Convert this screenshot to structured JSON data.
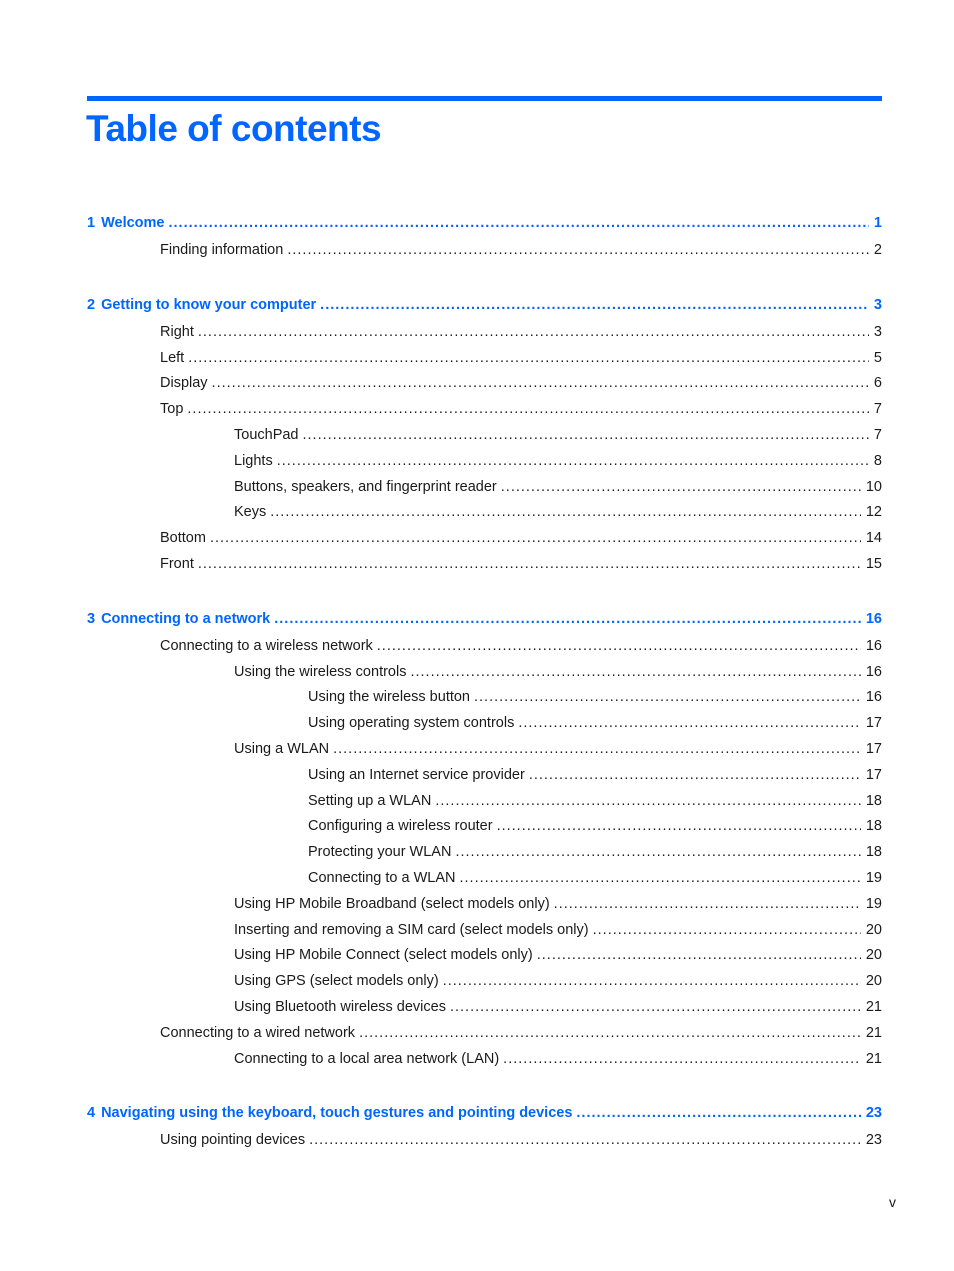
{
  "page": {
    "title": "Table of contents",
    "folio": "v",
    "accent_color": "#0066ff"
  },
  "toc": [
    {
      "level": 0,
      "number": "1",
      "label": "Welcome",
      "page": "1"
    },
    {
      "level": 1,
      "label": "Finding information",
      "page": "2"
    },
    {
      "level": 0,
      "number": "2",
      "label": "Getting to know your computer",
      "page": "3"
    },
    {
      "level": 1,
      "label": "Right",
      "page": "3"
    },
    {
      "level": 1,
      "label": "Left",
      "page": "5"
    },
    {
      "level": 1,
      "label": "Display",
      "page": "6"
    },
    {
      "level": 1,
      "label": "Top",
      "page": "7"
    },
    {
      "level": 2,
      "label": "TouchPad",
      "page": "7"
    },
    {
      "level": 2,
      "label": "Lights",
      "page": "8"
    },
    {
      "level": 2,
      "label": "Buttons, speakers, and fingerprint reader",
      "page": "10"
    },
    {
      "level": 2,
      "label": "Keys",
      "page": "12"
    },
    {
      "level": 1,
      "label": "Bottom",
      "page": "14"
    },
    {
      "level": 1,
      "label": "Front",
      "page": "15"
    },
    {
      "level": 0,
      "number": "3",
      "label": "Connecting to a network",
      "page": "16"
    },
    {
      "level": 1,
      "label": "Connecting to a wireless network",
      "page": "16"
    },
    {
      "level": 2,
      "label": "Using the wireless controls",
      "page": "16"
    },
    {
      "level": 3,
      "label": "Using the wireless button",
      "page": "16"
    },
    {
      "level": 3,
      "label": "Using operating system controls",
      "page": "17"
    },
    {
      "level": 2,
      "label": "Using a WLAN",
      "page": "17"
    },
    {
      "level": 3,
      "label": "Using an Internet service provider",
      "page": "17"
    },
    {
      "level": 3,
      "label": "Setting up a WLAN",
      "page": "18"
    },
    {
      "level": 3,
      "label": "Configuring a wireless router",
      "page": "18"
    },
    {
      "level": 3,
      "label": "Protecting your WLAN",
      "page": "18"
    },
    {
      "level": 3,
      "label": "Connecting to a WLAN",
      "page": "19"
    },
    {
      "level": 2,
      "label": "Using HP Mobile Broadband (select models only)",
      "page": "19"
    },
    {
      "level": 2,
      "label": "Inserting and removing a SIM card (select models only)",
      "page": "20"
    },
    {
      "level": 2,
      "label": "Using HP Mobile Connect (select models only)",
      "page": "20"
    },
    {
      "level": 2,
      "label": "Using GPS (select models only)",
      "page": "20"
    },
    {
      "level": 2,
      "label": "Using Bluetooth wireless devices",
      "page": "21"
    },
    {
      "level": 1,
      "label": "Connecting to a wired network",
      "page": "21"
    },
    {
      "level": 2,
      "label": "Connecting to a local area network (LAN)",
      "page": "21"
    },
    {
      "level": 0,
      "number": "4",
      "label": "Navigating using the keyboard, touch gestures and pointing devices",
      "page": "23"
    },
    {
      "level": 1,
      "label": "Using pointing devices",
      "page": "23"
    }
  ]
}
